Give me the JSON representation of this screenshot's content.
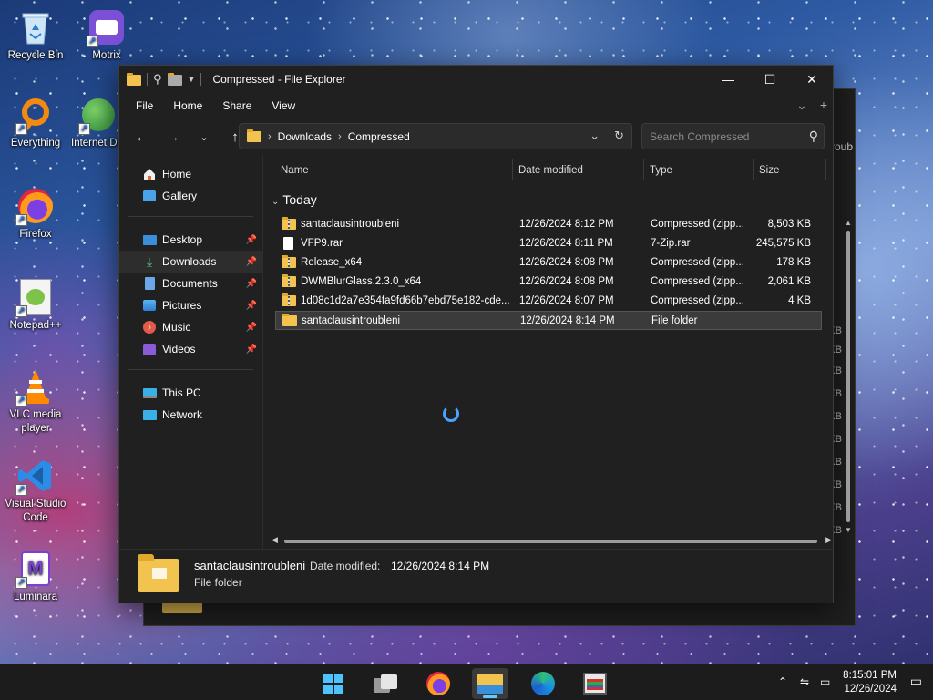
{
  "desktop": {
    "icons": [
      {
        "label": "Recycle Bin"
      },
      {
        "label": "Motrix"
      },
      {
        "label": "Everything"
      },
      {
        "label": "Internet Download..."
      },
      {
        "label": "Firefox"
      },
      {
        "label": "Notepad++"
      },
      {
        "label": "VLC media player"
      },
      {
        "label": "Visual Studio Code"
      },
      {
        "label": "Luminara"
      }
    ]
  },
  "background_window": {
    "title_fragment": "roub",
    "size_fragment": "KB"
  },
  "window": {
    "title": "Compressed - File Explorer",
    "menu": [
      "File",
      "Home",
      "Share",
      "View"
    ],
    "address": {
      "crumbs": [
        "Downloads",
        "Compressed"
      ]
    },
    "search": {
      "placeholder": "Search Compressed"
    },
    "sidebar": {
      "items": [
        {
          "label": "Home",
          "icon": "home-icon"
        },
        {
          "label": "Gallery",
          "icon": "gallery-icon"
        },
        {
          "label": "Desktop",
          "icon": "desktop-icon"
        },
        {
          "label": "Downloads",
          "icon": "download-icon"
        },
        {
          "label": "Documents",
          "icon": "documents-icon"
        },
        {
          "label": "Pictures",
          "icon": "pictures-icon"
        },
        {
          "label": "Music",
          "icon": "music-icon"
        },
        {
          "label": "Videos",
          "icon": "videos-icon"
        },
        {
          "label": "This PC",
          "icon": "pc-icon"
        },
        {
          "label": "Network",
          "icon": "network-icon"
        }
      ]
    },
    "columns": {
      "name": "Name",
      "date": "Date modified",
      "type": "Type",
      "size": "Size"
    },
    "group": "Today",
    "files": [
      {
        "name": "santaclausintroubleni",
        "date": "12/26/2024 8:12 PM",
        "type": "Compressed (zipp...",
        "size": "8,503 KB",
        "icon": "zip-folder-icon"
      },
      {
        "name": "VFP9.rar",
        "date": "12/26/2024 8:11 PM",
        "type": "7-Zip.rar",
        "size": "245,575 KB",
        "icon": "file-icon"
      },
      {
        "name": "Release_x64",
        "date": "12/26/2024 8:08 PM",
        "type": "Compressed (zipp...",
        "size": "178 KB",
        "icon": "zip-folder-icon"
      },
      {
        "name": "DWMBlurGlass.2.3.0_x64",
        "date": "12/26/2024 8:08 PM",
        "type": "Compressed (zipp...",
        "size": "2,061 KB",
        "icon": "zip-folder-icon"
      },
      {
        "name": "1d08c1d2a7e354fa9fd66b7ebd75e182-cde...",
        "date": "12/26/2024 8:07 PM",
        "type": "Compressed (zipp...",
        "size": "4 KB",
        "icon": "zip-folder-icon"
      },
      {
        "name": "santaclausintroubleni",
        "date": "12/26/2024 8:14 PM",
        "type": "File folder",
        "size": "",
        "icon": "folder-icon"
      }
    ],
    "details": {
      "name": "santaclausintroubleni",
      "date_label": "Date modified:",
      "date_value": "12/26/2024 8:14 PM",
      "type": "File folder"
    }
  },
  "taskbar": {
    "time": "8:15:01 PM",
    "date": "12/26/2024"
  },
  "colors": {
    "accent": "#60cdff",
    "folder": "#f2c44f",
    "window_bg": "#202020"
  }
}
